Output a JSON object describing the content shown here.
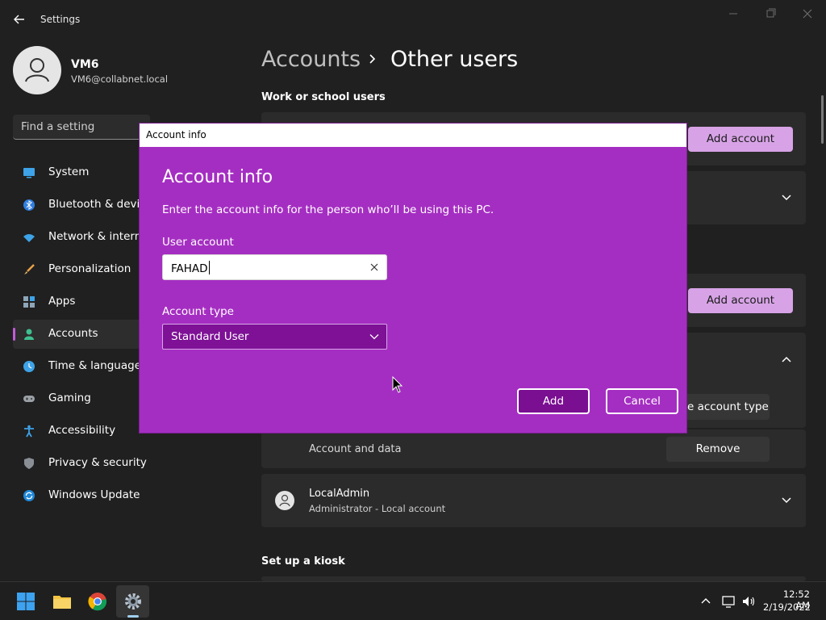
{
  "window": {
    "title": "Settings"
  },
  "profile": {
    "name": "VM6",
    "email": "VM6@collabnet.local"
  },
  "search": {
    "placeholder": "Find a setting"
  },
  "nav": {
    "items": [
      {
        "label": "System",
        "icon": "monitor-icon"
      },
      {
        "label": "Bluetooth & devic",
        "icon": "bluetooth-icon"
      },
      {
        "label": "Network & interne",
        "icon": "wifi-icon"
      },
      {
        "label": "Personalization",
        "icon": "brush-icon"
      },
      {
        "label": "Apps",
        "icon": "apps-icon"
      },
      {
        "label": "Accounts",
        "icon": "person-icon",
        "active": true
      },
      {
        "label": "Time & language",
        "icon": "clock-icon"
      },
      {
        "label": "Gaming",
        "icon": "gamepad-icon"
      },
      {
        "label": "Accessibility",
        "icon": "accessibility-icon"
      },
      {
        "label": "Privacy & security",
        "icon": "shield-icon"
      },
      {
        "label": "Windows Update",
        "icon": "update-icon"
      }
    ]
  },
  "breadcrumb": {
    "parent": "Accounts",
    "current": "Other users"
  },
  "main": {
    "work_school_title": "Work or school users",
    "add_account_label": "Add account",
    "change_account_type_label": "e account type",
    "account_and_data": "Account and data",
    "remove_label": "Remove",
    "local_admin": {
      "name": "LocalAdmin",
      "sub": "Administrator - Local account"
    },
    "kiosk_title": "Set up a kiosk"
  },
  "dialog": {
    "titlebar": "Account info",
    "heading": "Account info",
    "description": "Enter the account info for the person who’ll be using this PC.",
    "user_account_label": "User account",
    "user_account_value": "FAHAD",
    "account_type_label": "Account type",
    "account_type_value": "Standard User",
    "add_label": "Add",
    "cancel_label": "Cancel"
  },
  "taskbar": {
    "time": "12:52 AM",
    "date": "2/19/2022"
  },
  "colors": {
    "accent": "#a52ec2",
    "accent_dark": "#7a0f92",
    "button_light": "#d7a3e6"
  }
}
